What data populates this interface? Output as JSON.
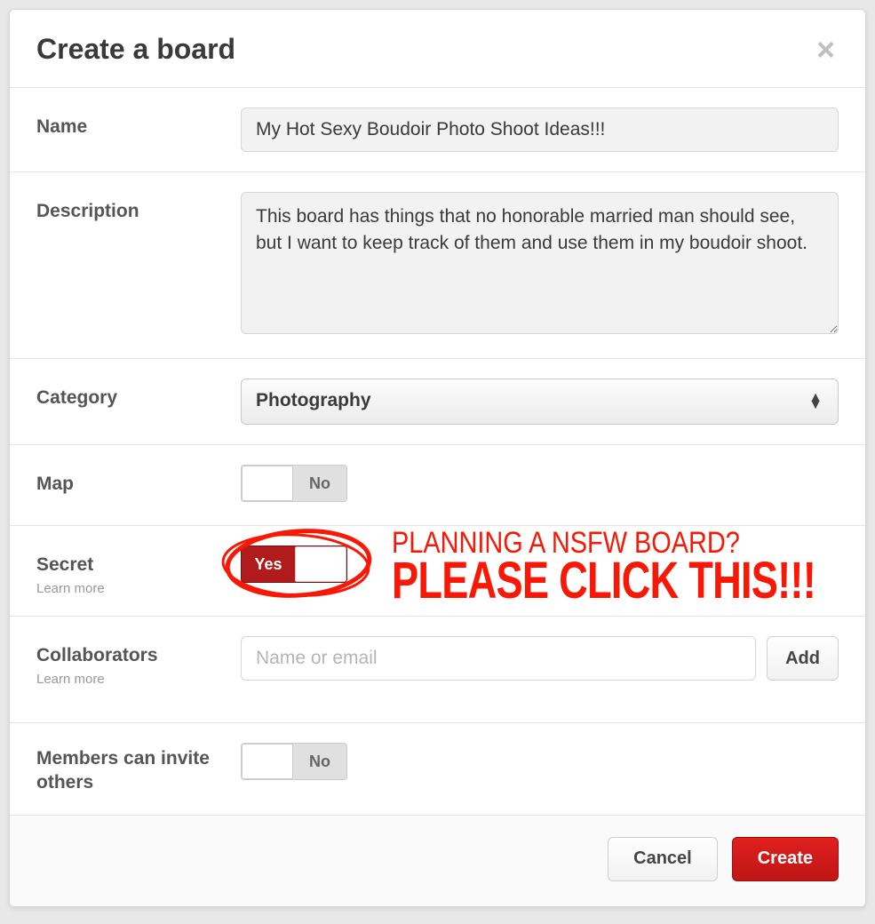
{
  "header": {
    "title": "Create a board"
  },
  "fields": {
    "name": {
      "label": "Name",
      "value": "My Hot Sexy Boudoir Photo Shoot Ideas!!!"
    },
    "description": {
      "label": "Description",
      "value": "This board has things that no honorable married man should see, but I want to keep track of them and use them in my boudoir shoot."
    },
    "category": {
      "label": "Category",
      "value": "Photography"
    },
    "map": {
      "label": "Map",
      "state": "off",
      "off_label": "No"
    },
    "secret": {
      "label": "Secret",
      "sub": "Learn more",
      "state": "on",
      "on_label": "Yes"
    },
    "collaborators": {
      "label": "Collaborators",
      "sub": "Learn more",
      "placeholder": "Name or email",
      "add_label": "Add"
    },
    "invite": {
      "label": "Members can invite others",
      "state": "off",
      "off_label": "No"
    }
  },
  "footer": {
    "cancel": "Cancel",
    "create": "Create"
  },
  "annotation": {
    "line1": "Planning a NSFW board?",
    "line2": "Please click this!!!",
    "color": "#f91806"
  }
}
